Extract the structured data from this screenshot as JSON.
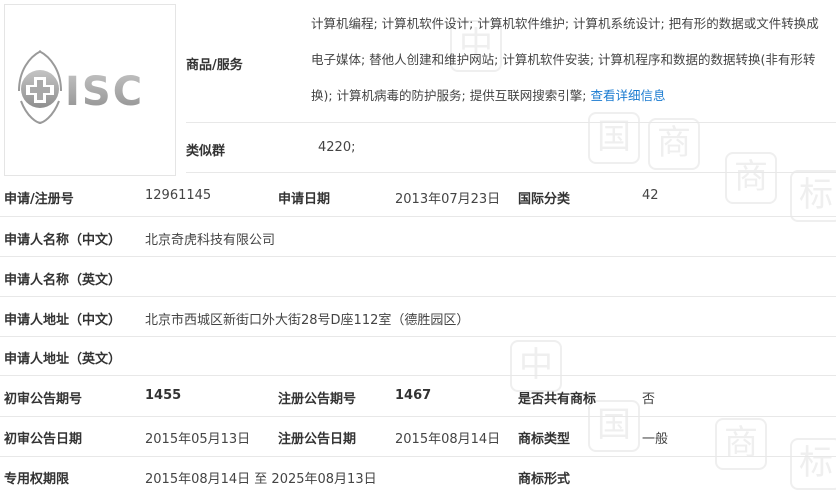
{
  "logo": {
    "text": "ISC",
    "colors": {
      "logo_gray": "#9a9a9a"
    }
  },
  "goods": {
    "label": "商品/服务",
    "text": "计算机编程; 计算机软件设计; 计算机软件维护; 计算机系统设计; 把有形的数据或文件转换成电子媒体; 替他人创建和维护网站; 计算机软件安装; 计算机程序和数据的数据转换(非有形转换); 计算机病毒的防护服务; 提供互联网搜索引擎; ",
    "link": "查看详细信息"
  },
  "similar": {
    "label": "类似群",
    "value": "4220;"
  },
  "rows": {
    "reg_no": {
      "label": "申请/注册号",
      "value": "12961145"
    },
    "app_date": {
      "label": "申请日期",
      "value": "2013年07月23日"
    },
    "intl_class": {
      "label": "国际分类",
      "value": "42"
    },
    "applicant_cn": {
      "label": "申请人名称（中文）",
      "value": "北京奇虎科技有限公司"
    },
    "applicant_en": {
      "label": "申请人名称（英文）",
      "value": ""
    },
    "address_cn": {
      "label": "申请人地址（中文）",
      "value": "北京市西城区新街口外大街28号D座112室（德胜园区）"
    },
    "address_en": {
      "label": "申请人地址（英文）",
      "value": ""
    },
    "prelim_no": {
      "label": "初审公告期号",
      "value": "1455"
    },
    "reg_pub_no": {
      "label": "注册公告期号",
      "value": "1467"
    },
    "shared": {
      "label": "是否共有商标",
      "value": "否"
    },
    "prelim_date": {
      "label": "初审公告日期",
      "value": "2015年05月13日"
    },
    "reg_pub_date": {
      "label": "注册公告日期",
      "value": "2015年08月14日"
    },
    "tm_type": {
      "label": "商标类型",
      "value": "一般"
    },
    "exclusive": {
      "label": "专用权期限",
      "value": "2015年08月14日 至 2025年08月13日"
    },
    "tm_form": {
      "label": "商标形式",
      "value": ""
    }
  }
}
